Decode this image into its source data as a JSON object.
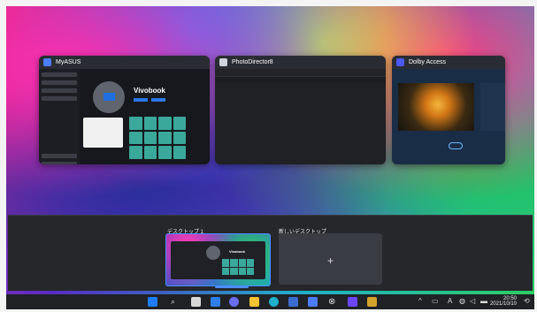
{
  "windows": [
    {
      "title": "MyASUS",
      "icon_color": "#4c7dff"
    },
    {
      "title": "PhotoDirector8",
      "icon_color": "#d1d3da"
    },
    {
      "title": "Dolby Access",
      "icon_color": "#4a58ff"
    }
  ],
  "myasus": {
    "device_name": "Vivobook"
  },
  "desktops": {
    "current_label": "デスクトップ 1",
    "new_label": "新しいデスクトップ",
    "plus": "+",
    "mini_device_name": "Vivobook"
  },
  "taskbar": {
    "time": "20:50",
    "date": "2021/10/10",
    "ime_mode": "A",
    "icons": [
      "windows-icon",
      "search-icon",
      "task-view-icon",
      "widgets-icon",
      "teams-chat-icon",
      "file-explorer-icon",
      "edge-icon",
      "store-icon",
      "myasus-icon",
      "xbox-icon",
      "media-icon",
      "photodirector-icon"
    ]
  }
}
